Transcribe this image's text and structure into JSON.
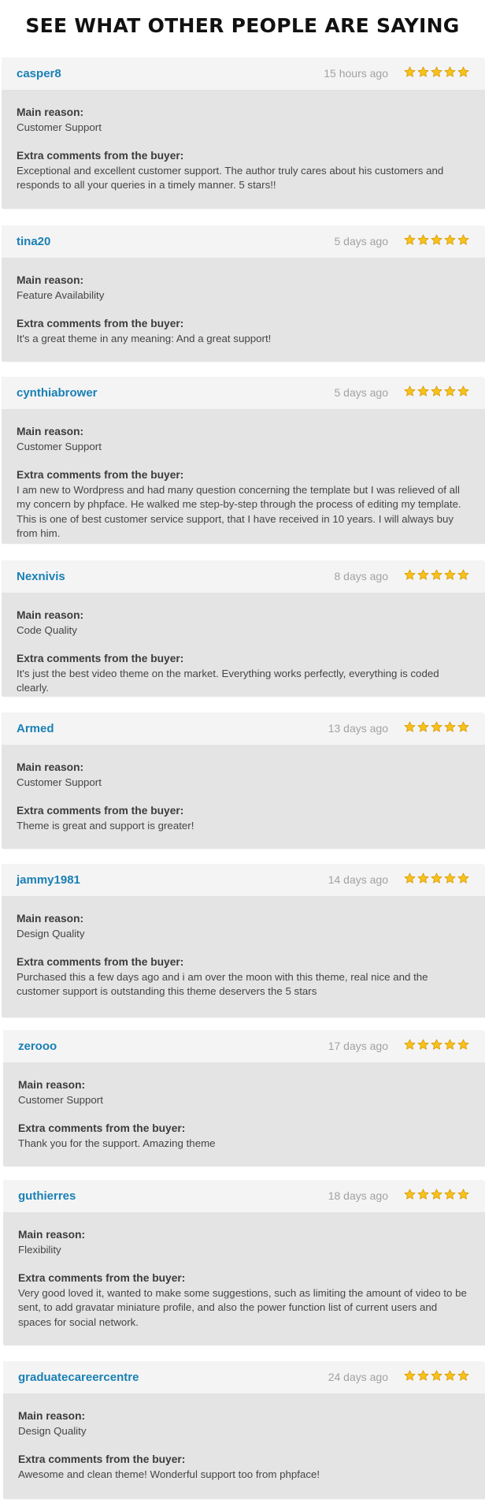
{
  "page": {
    "title": "SEE WHAT OTHER PEOPLE ARE SAYING"
  },
  "labels": {
    "main_reason": "Main reason:",
    "extra_comments": "Extra comments from the buyer:"
  },
  "colors": {
    "username": "#1a80b5",
    "timestamp": "#a2a2a2",
    "header_bg": "#f4f4f4",
    "body_bg": "#e4e4e4",
    "star_fill": "#f7c21a",
    "star_stroke": "#d99a07"
  },
  "reviews": [
    {
      "username": "casper8",
      "time_ago": "15 hours ago",
      "rating": 5,
      "rating_max": 5,
      "main_reason": "Customer Support",
      "comment": "Exceptional and excellent customer support. The author truly cares about his customers and responds to all your queries in a timely manner. 5 stars!!"
    },
    {
      "username": "tina20",
      "time_ago": "5 days ago",
      "rating": 5,
      "rating_max": 5,
      "main_reason": "Feature Availability",
      "comment": "It's a great theme in any meaning: And a great support!"
    },
    {
      "username": "cynthiabrower",
      "time_ago": "5 days ago",
      "rating": 5,
      "rating_max": 5,
      "main_reason": "Customer Support",
      "comment": "I am new to Wordpress and had many question concerning the template but I was relieved of all my concern by phpface. He walked me step-by-step through the process of editing my template. This is one of best customer service support, that I have received in 10 years. I will always buy from him."
    },
    {
      "username": "Nexnivis",
      "time_ago": "8 days ago",
      "rating": 5,
      "rating_max": 5,
      "main_reason": "Code Quality",
      "comment": "It's just the best video theme on the market. Everything works perfectly, everything is coded clearly."
    },
    {
      "username": "Armed",
      "time_ago": "13 days ago",
      "rating": 5,
      "rating_max": 5,
      "main_reason": "Customer Support",
      "comment": "Theme is great and support is greater!"
    },
    {
      "username": "jammy1981",
      "time_ago": "14 days ago",
      "rating": 5,
      "rating_max": 5,
      "main_reason": "Design Quality",
      "comment": "Purchased this a few days ago and i am over the moon with this theme, real nice and the customer support is outstanding this theme deservers the 5 stars"
    },
    {
      "username": "zerooo",
      "time_ago": "17 days ago",
      "rating": 5,
      "rating_max": 5,
      "main_reason": "Customer Support",
      "comment": "Thank you for the support. Amazing theme"
    },
    {
      "username": "guthierres",
      "time_ago": "18 days ago",
      "rating": 5,
      "rating_max": 5,
      "main_reason": "Flexibility",
      "comment": "Very good loved it, wanted to make some suggestions, such as limiting the amount of video to be sent, to add gravatar miniature profile, and also the power function list of current users and spaces for social network."
    },
    {
      "username": "graduatecareercentre",
      "time_ago": "24 days ago",
      "rating": 5,
      "rating_max": 5,
      "main_reason": "Design Quality",
      "comment": "Awesome and clean theme! Wonderful support too from phpface!"
    }
  ]
}
